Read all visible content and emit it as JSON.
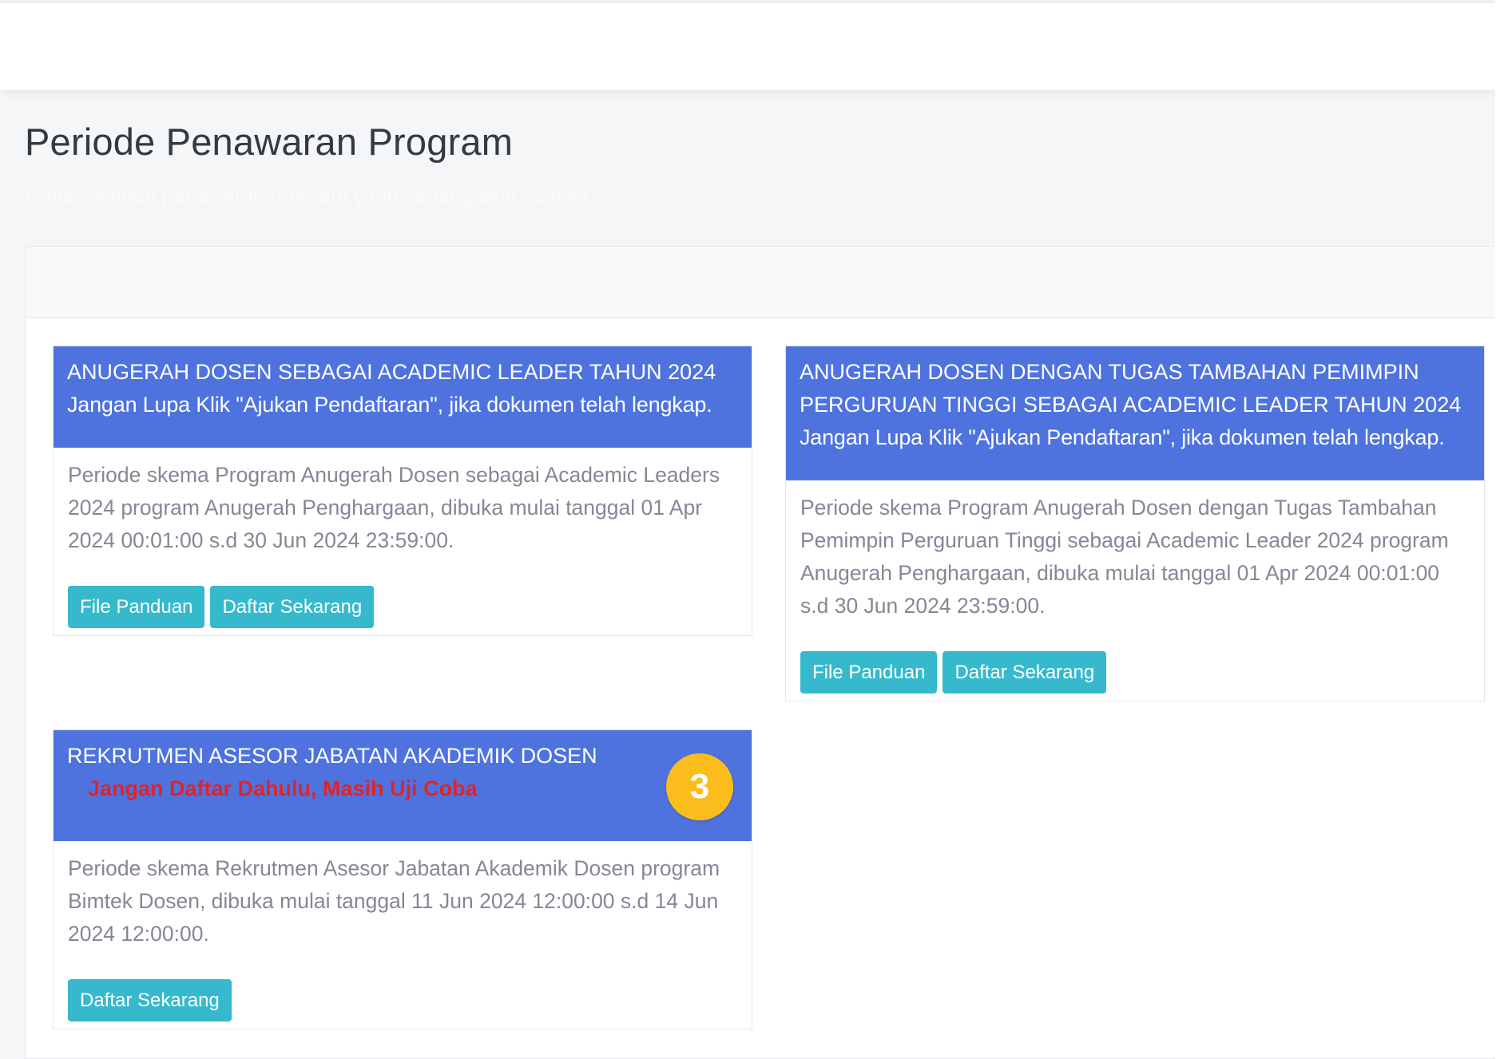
{
  "page": {
    "title": "Periode Penawaran Program",
    "subtitle": "Daftar periode penawaran program yang sedang aktif saat ini."
  },
  "programs": [
    {
      "head_title": "ANUGERAH DOSEN SEBAGAI ACADEMIC LEADER TAHUN 2024",
      "head_note": "Jangan Lupa Klik \"Ajukan Pendaftaran\", jika dokumen telah lengkap.",
      "description": "Periode skema Program Anugerah Dosen sebagai Academic Leaders 2024 program Anugerah Penghargaan, dibuka mulai tanggal 01 Apr 2024 00:01:00 s.d 30 Jun 2024 23:59:00.",
      "btn_guide": "File Panduan",
      "btn_register": "Daftar Sekarang"
    },
    {
      "head_title": "ANUGERAH DOSEN DENGAN TUGAS TAMBAHAN PEMIMPIN PERGURUAN TINGGI SEBAGAI ACADEMIC LEADER TAHUN 2024",
      "head_note": "Jangan Lupa Klik \"Ajukan Pendaftaran\", jika dokumen telah lengkap.",
      "description": "Periode skema Program Anugerah Dosen dengan Tugas Tambahan Pemimpin Perguruan Tinggi sebagai Academic Leader 2024 program Anugerah Penghargaan, dibuka mulai tanggal 01 Apr 2024 00:01:00 s.d 30 Jun 2024 23:59:00.",
      "btn_guide": "File Panduan",
      "btn_register": "Daftar Sekarang"
    },
    {
      "head_title": "REKRUTMEN ASESOR JABATAN AKADEMIK DOSEN",
      "head_warning": "Jangan Daftar Dahulu, Masih Uji Coba",
      "description": "Periode skema Rekrutmen Asesor Jabatan Akademik Dosen program Bimtek Dosen, dibuka mulai tanggal 11 Jun 2024 12:00:00 s.d 14 Jun 2024 12:00:00.",
      "btn_register": "Daftar Sekarang"
    }
  ],
  "step_badge": "3",
  "colors": {
    "header_blue": "#4e73df",
    "button_teal": "#36b9cc",
    "warning_red": "#e02424",
    "badge_yellow": "#fbbd1b"
  }
}
